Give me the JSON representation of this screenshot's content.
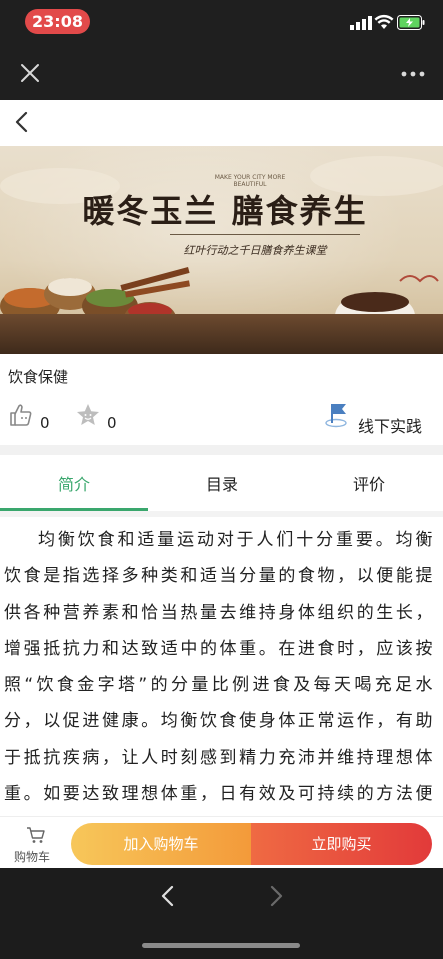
{
  "status_bar": {
    "time": "23:08"
  },
  "header": {
    "back_icon": "chevron-left-icon"
  },
  "banner": {
    "tagline_small": "MAKE YOUR CITY MORE BEAUTIFUL",
    "title": "暖冬玉兰 膳食养生",
    "subtitle": "红叶行动之千日膳食养生课堂"
  },
  "course": {
    "title": "饮食保健",
    "likes": "0",
    "favorites": "0",
    "practice_label": "线下实践"
  },
  "tabs": [
    {
      "label": "简介",
      "active": true
    },
    {
      "label": "目录",
      "active": false
    },
    {
      "label": "评价",
      "active": false
    }
  ],
  "intro_text": "均衡饮食和适量运动对于人们十分重要。均衡饮食是指选择多种类和适当分量的食物，以便能提供各种营养素和恰当热量去维持身体组织的生长，增强抵抗力和达致适中的体重。在进食时，应该按照“饮食金字塔”的分量比例进食及每天喝充足水分，以促进健康。均衡饮食使身体正常运作，有助于抵抗疾病，让人时刻感到精力充沛并维持理想体重。如要达致理想体重，日有效及可持续的方法便是保持健康",
  "action_bar": {
    "cart_label": "购物车",
    "add_to_cart": "加入购物车",
    "buy_now": "立即购买"
  },
  "colors": {
    "accent_green": "#3aa76d",
    "add_cart_orange": "#f5b14a",
    "buy_now_red": "#e5443c",
    "time_pill": "#e24a4a"
  }
}
